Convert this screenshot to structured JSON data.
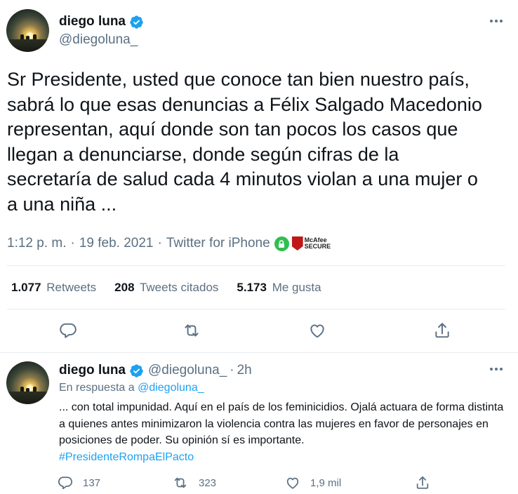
{
  "main_tweet": {
    "author_name": "diego luna",
    "author_handle": "@diegoluna_",
    "text": "Sr Presidente, usted que conoce tan bien nuestro país,\nsabrá lo que esas denuncias a Félix Salgado Macedonio\nrepresentan, aquí donde son tan pocos los casos que\nllegan a denunciarse, donde según cifras de la\nsecretaría de salud cada 4 minutos violan a una mujer o\na una niña ...",
    "time": "1:12 p. m.",
    "separator": "·",
    "date": "19 feb. 2021",
    "source": "Twitter for iPhone",
    "badge_line1": "McAfee",
    "badge_line2": "SECURE",
    "stats": {
      "retweets_count": "1.077",
      "retweets_label": "Retweets",
      "quotes_count": "208",
      "quotes_label": "Tweets citados",
      "likes_count": "5.173",
      "likes_label": "Me gusta"
    }
  },
  "reply_tweet": {
    "author_name": "diego luna",
    "author_handle": "@diegoluna_",
    "time_ago": "2h",
    "separator": "·",
    "reply_prefix": "En respuesta a",
    "reply_to": "@diegoluna_",
    "text": "... con total impunidad. Aquí en el país de los feminicidios. Ojalá actuara de forma distinta a quienes antes minimizaron la violencia contra las mujeres en favor de personajes en posiciones de poder. Su opinión sí es importante.",
    "hashtag": "#PresidenteRompaElPacto",
    "reply_count": "137",
    "retweet_count": "323",
    "like_count": "1,9 mil"
  },
  "colors": {
    "verified_blue": "#1da1f2",
    "secondary_text": "#5b7083",
    "link": "#1da1f2"
  }
}
